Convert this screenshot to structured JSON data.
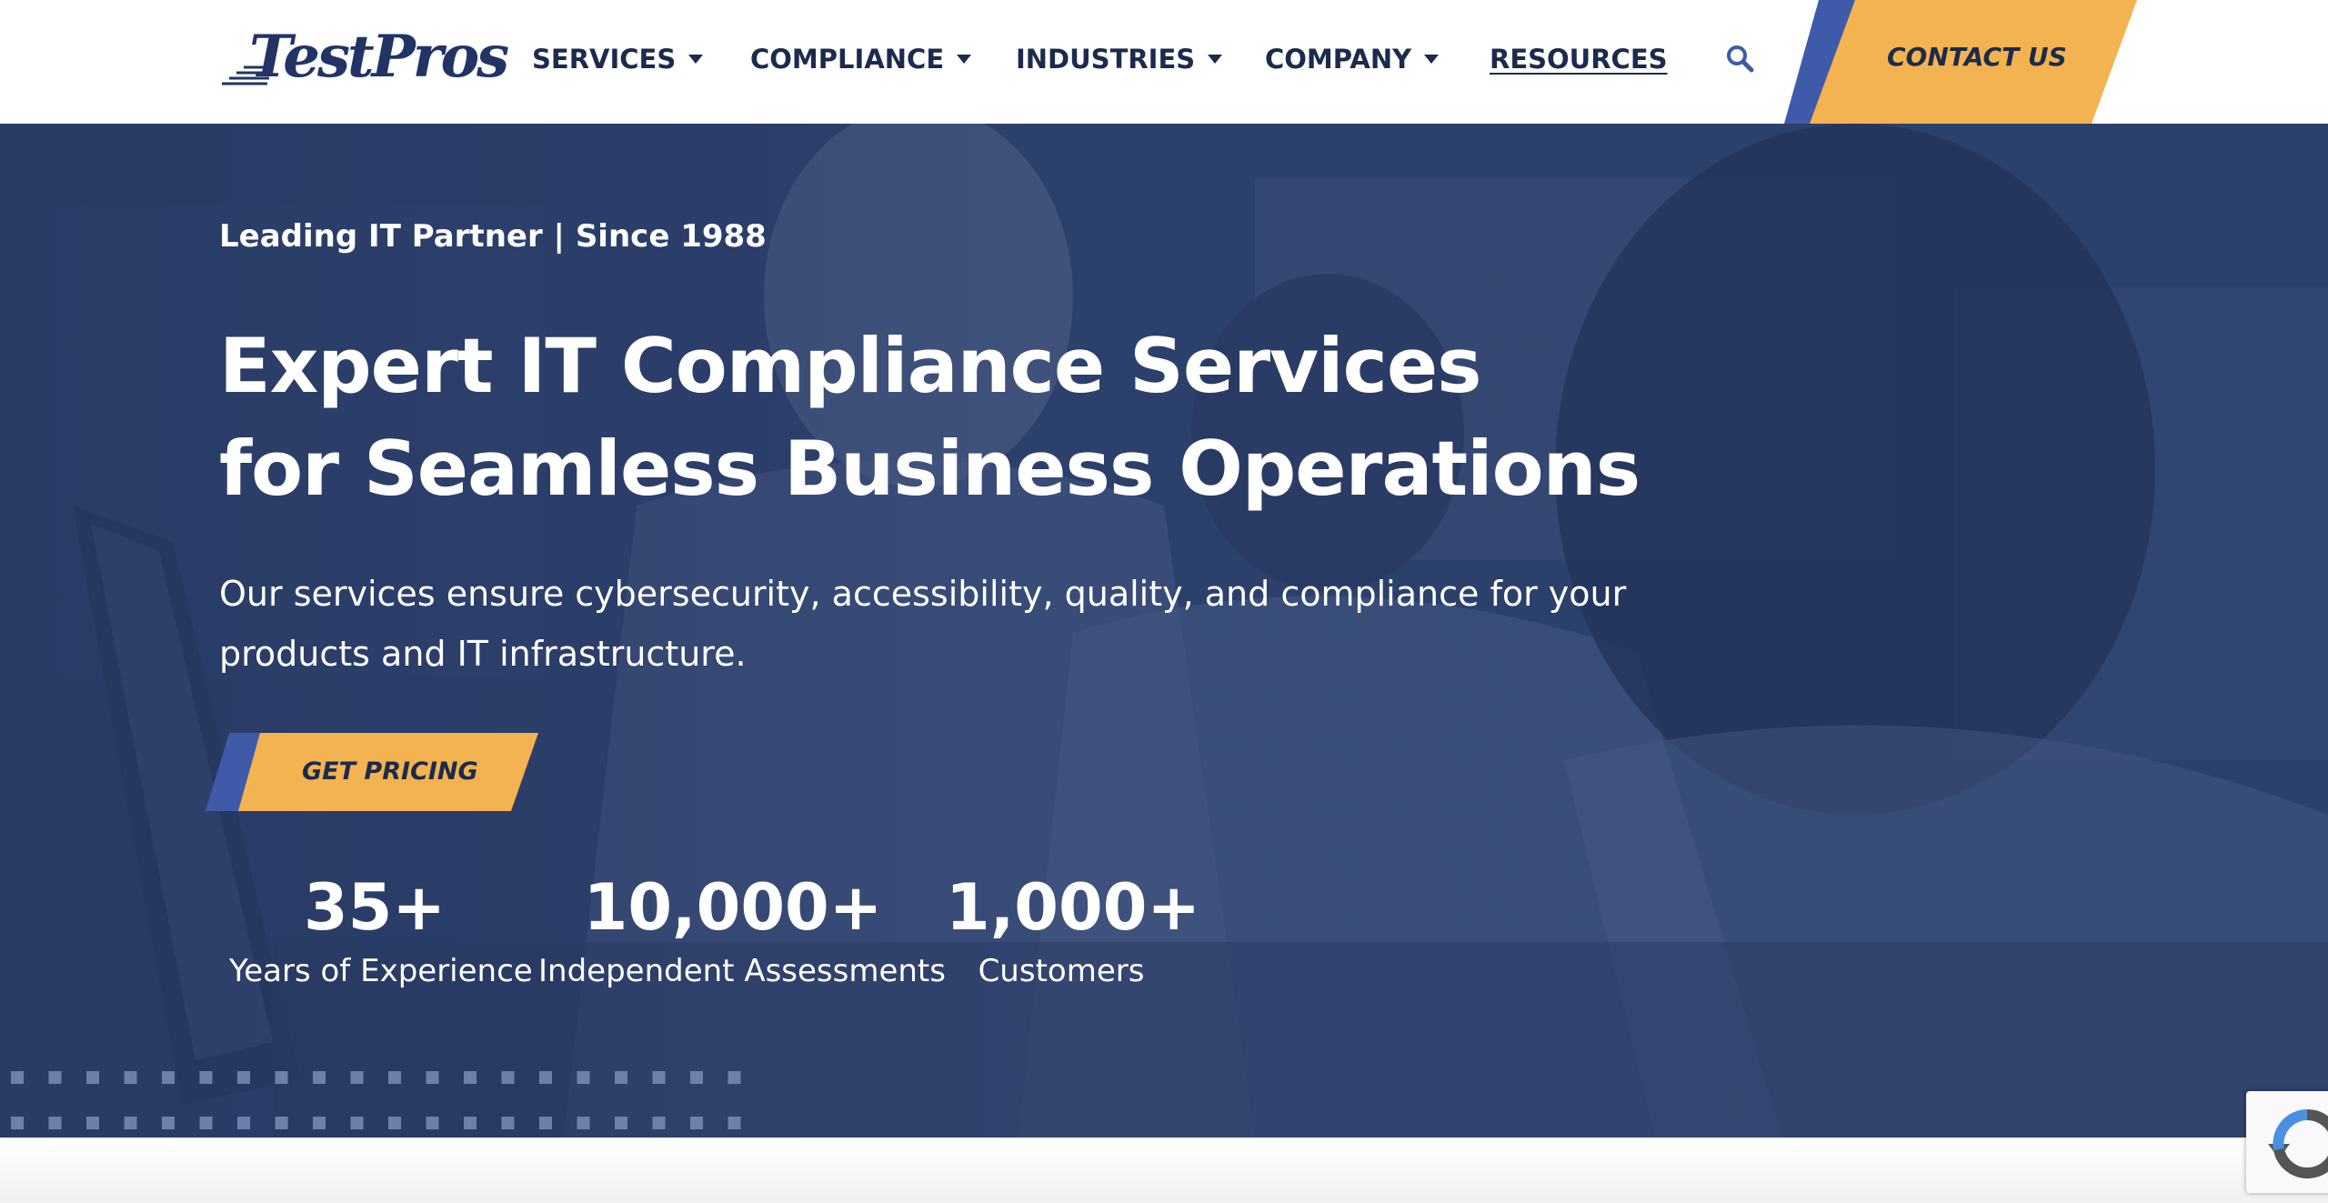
{
  "brand": {
    "logo_text": "TestPros"
  },
  "nav": {
    "items": [
      {
        "label": "SERVICES",
        "has_dropdown": true
      },
      {
        "label": "COMPLIANCE",
        "has_dropdown": true
      },
      {
        "label": "INDUSTRIES",
        "has_dropdown": true
      },
      {
        "label": "COMPANY",
        "has_dropdown": true
      },
      {
        "label": "RESOURCES",
        "has_dropdown": false
      }
    ],
    "search_icon": "search-icon",
    "contact_label": "CONTACT US"
  },
  "hero": {
    "eyebrow": "Leading IT Partner | Since 1988",
    "title_lines": [
      "Expert IT Compliance Services",
      "for Seamless Business Operations"
    ],
    "subtitle_lines": [
      "Our services ensure cybersecurity, accessibility, quality, and compliance for your",
      "products and IT infrastructure."
    ],
    "cta_label": "GET PRICING",
    "stats": [
      {
        "value": "35+",
        "label": "Years of Experience"
      },
      {
        "value": "10,000+",
        "label": "Independent Assessments"
      },
      {
        "value": "1,000+",
        "label": "Customers"
      }
    ]
  },
  "colors": {
    "brand_navy": "#1c2a4d",
    "accent_orange": "#f2b350",
    "accent_blue": "#3f5aa8",
    "hero_overlay": "#263860"
  },
  "widgets": {
    "recaptcha_icon": "recaptcha-icon"
  }
}
